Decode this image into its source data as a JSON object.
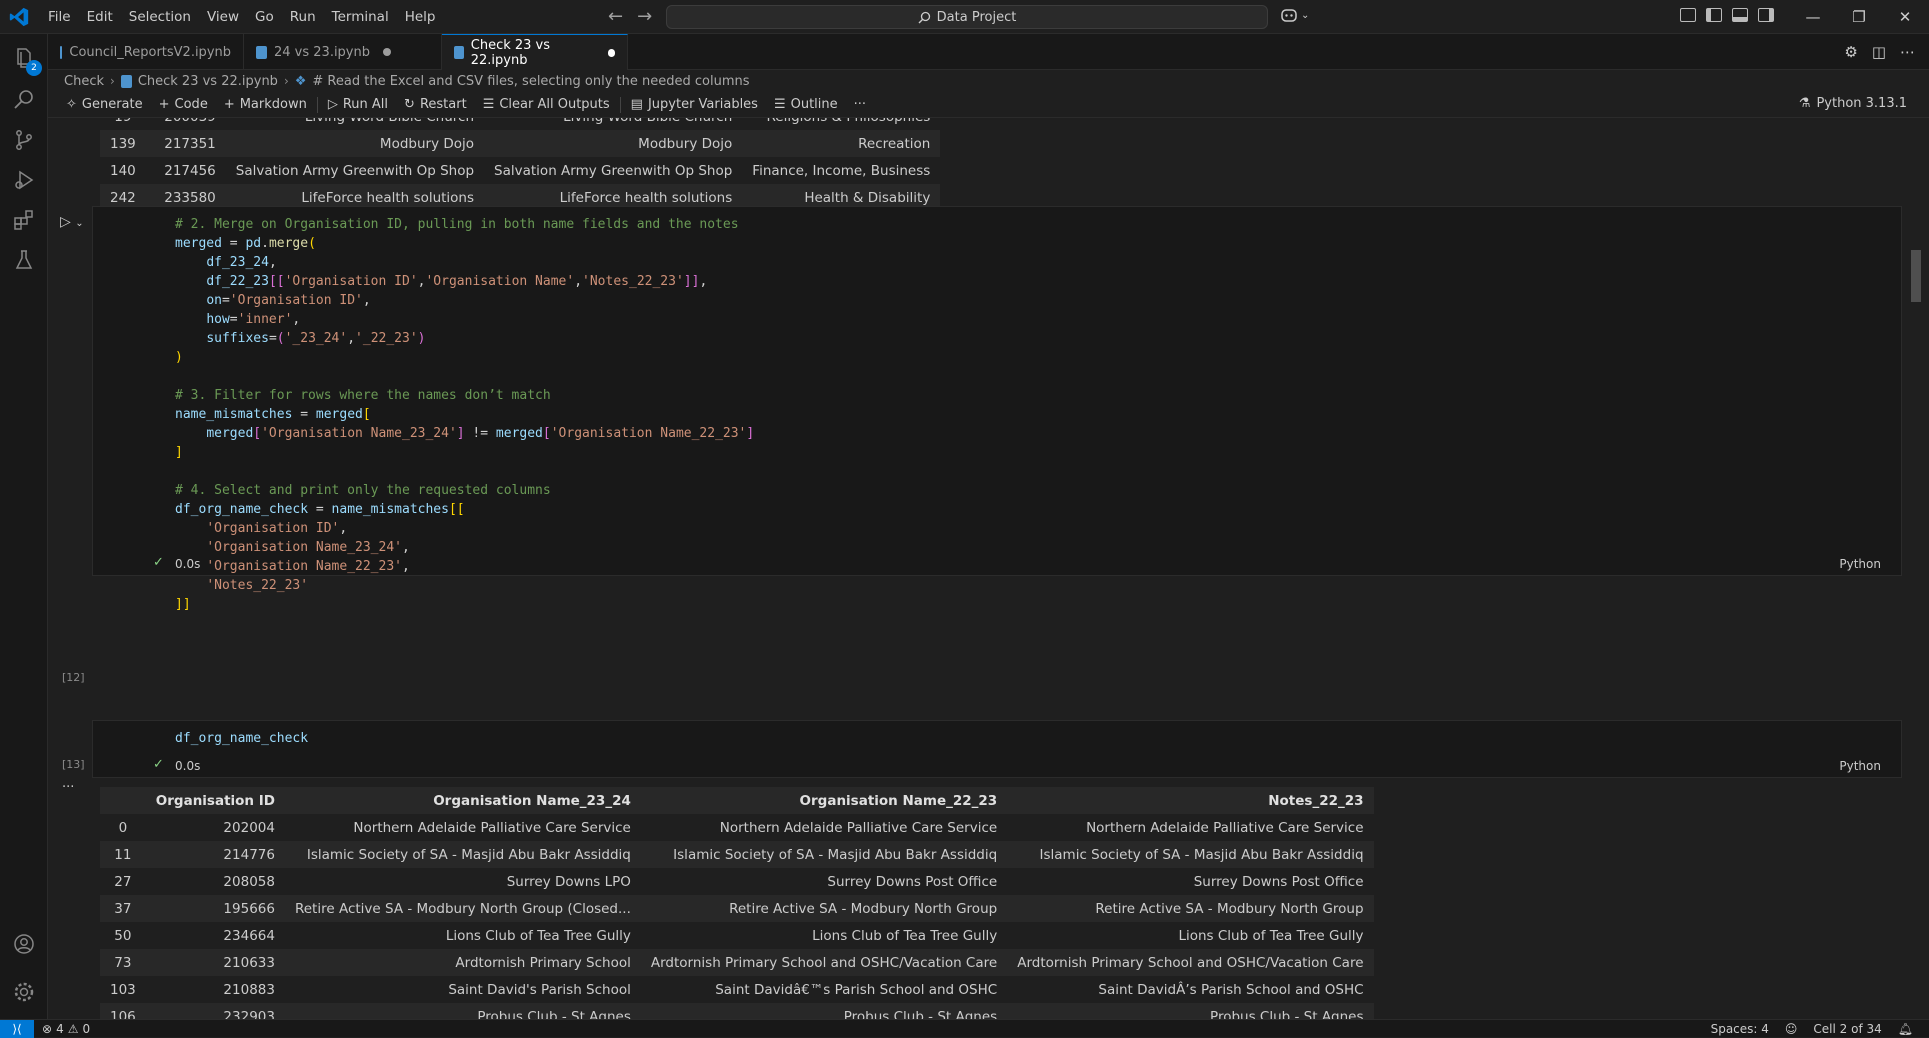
{
  "menu": [
    "File",
    "Edit",
    "Selection",
    "View",
    "Go",
    "Run",
    "Terminal",
    "Help"
  ],
  "command_center": "Data Project",
  "tabs": [
    {
      "label": "Council_ReportsV2.ipynb",
      "modified": false
    },
    {
      "label": "24 vs 23.ipynb",
      "modified": true
    },
    {
      "label": "Check 23 vs 22.ipynb",
      "modified": true,
      "active": true
    }
  ],
  "breadcrumb": {
    "folder": "Check",
    "file": "Check 23 vs 22.ipynb",
    "cell": "# Read the Excel and CSV files, selecting only the needed columns"
  },
  "toolbar": {
    "generate": "Generate",
    "code": "Code",
    "markdown": "Markdown",
    "run_all": "Run All",
    "restart": "Restart",
    "clear_outputs": "Clear All Outputs",
    "variables": "Jupyter Variables",
    "outline": "Outline",
    "more": "···",
    "kernel": "Python 3.13.1"
  },
  "top_table": {
    "rows": [
      [
        "19",
        "200039",
        "Living Word Bible Church",
        "Living Word Bible Church",
        "Religions & Philosophies"
      ],
      [
        "139",
        "217351",
        "Modbury Dojo",
        "Modbury Dojo",
        "Recreation"
      ],
      [
        "140",
        "217456",
        "Salvation Army Greenwith Op Shop",
        "Salvation Army Greenwith Op Shop",
        "Finance, Income, Business"
      ],
      [
        "242",
        "233580",
        "LifeForce health solutions",
        "LifeForce health solutions",
        "Health & Disability"
      ]
    ]
  },
  "cell12": {
    "exec_count": "[12]",
    "duration": "0.0s",
    "language": "Python"
  },
  "cell13": {
    "exec_count": "[13]",
    "code": "df_org_name_check",
    "duration": "0.0s",
    "language": "Python",
    "output_more": "···"
  },
  "output_table": {
    "columns": [
      "",
      "Organisation ID",
      "Organisation Name_23_24",
      "Organisation Name_22_23",
      "Notes_22_23"
    ],
    "rows": [
      [
        "0",
        "202004",
        "Northern Adelaide Palliative Care Service",
        "Northern Adelaide Palliative Care Service",
        "Northern Adelaide Palliative Care Service"
      ],
      [
        "11",
        "214776",
        "Islamic Society of SA - Masjid Abu Bakr Assiddiq",
        "Islamic Society of SA - Masjid Abu Bakr Assiddiq",
        "Islamic Society of SA - Masjid Abu Bakr Assiddiq"
      ],
      [
        "27",
        "208058",
        "Surrey Downs LPO",
        "Surrey Downs Post Office",
        "Surrey Downs Post Office"
      ],
      [
        "37",
        "195666",
        "Retire Active SA - Modbury North Group (Closed...",
        "Retire Active SA - Modbury North Group",
        "Retire Active SA - Modbury North Group"
      ],
      [
        "50",
        "234664",
        "Lions Club of Tea Tree Gully",
        "Lions Club of Tea Tree Gully",
        "Lions Club of Tea Tree Gully"
      ],
      [
        "73",
        "210633",
        "Ardtornish Primary School",
        "Ardtornish Primary School and OSHC/Vacation Care",
        "Ardtornish Primary School and OSHC/Vacation Care"
      ],
      [
        "103",
        "210883",
        "Saint David's Parish School",
        "Saint Davidâ€™s Parish School and OSHC",
        "Saint DavidÂ’s Parish School and OSHC"
      ],
      [
        "106",
        "232903",
        "Probus Club - St Agnes",
        "Probus Club - St Agnes",
        "Probus Club - St Agnes"
      ]
    ]
  },
  "status": {
    "errors": "4",
    "warnings": "0",
    "spaces": "Spaces: 4",
    "cell_pos": "Cell 2 of 34"
  },
  "colors": {
    "accent": "#0078d4",
    "success": "#89d185"
  }
}
